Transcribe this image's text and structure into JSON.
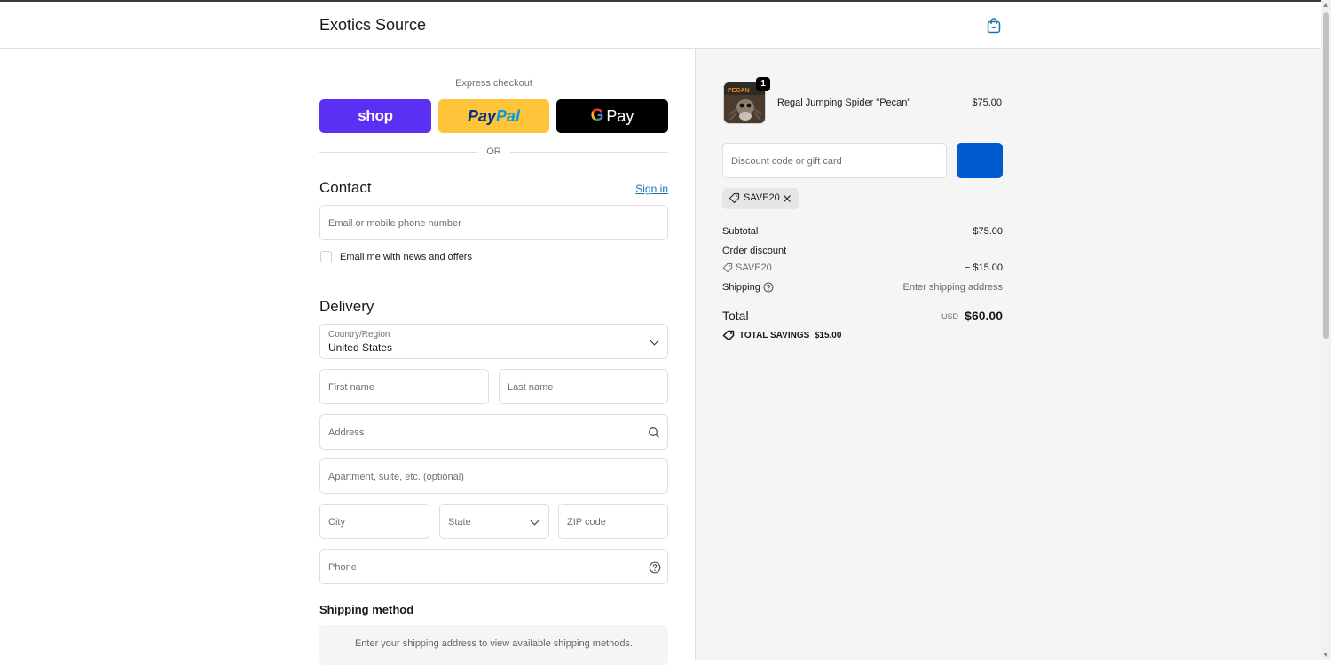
{
  "header": {
    "brand": "Exotics Source",
    "cart_icon": "shopping-bag-icon"
  },
  "express": {
    "label": "Express checkout",
    "shop_label": "shop",
    "paypal_label_1": "Pay",
    "paypal_label_2": "Pal",
    "gpay_g": "G",
    "gpay_label": "Pay",
    "or": "OR"
  },
  "contact": {
    "title": "Contact",
    "sign_in": "Sign in",
    "email_placeholder": "Email or mobile phone number",
    "news_label": "Email me with news and offers"
  },
  "delivery": {
    "title": "Delivery",
    "country_label": "Country/Region",
    "country_value": "United States",
    "first_name": "First name",
    "last_name": "Last name",
    "address": "Address",
    "apartment": "Apartment, suite, etc. (optional)",
    "city": "City",
    "state": "State",
    "zip": "ZIP code",
    "phone": "Phone"
  },
  "shipping": {
    "title": "Shipping method",
    "message": "Enter your shipping address to view available shipping methods."
  },
  "summary": {
    "product": {
      "name": "Regal Jumping Spider \"Pecan\"",
      "price": "$75.00",
      "quantity": "1",
      "thumb_text": "PECAN"
    },
    "discount_placeholder": "Discount code or gift card",
    "applied_code": "SAVE20",
    "subtotal_label": "Subtotal",
    "subtotal_value": "$75.00",
    "order_discount_label": "Order discount",
    "discount_code": "SAVE20",
    "discount_value": "− $15.00",
    "shipping_label": "Shipping",
    "shipping_value": "Enter shipping address",
    "total_label": "Total",
    "total_currency": "USD",
    "total_value": "$60.00",
    "savings_label": "TOTAL SAVINGS",
    "savings_value": "$15.00"
  },
  "colors": {
    "shop": "#5a31f4",
    "paypal": "#ffc439",
    "gpay": "#000000",
    "apply_button": "#005bd1",
    "link": "#1773b0"
  }
}
